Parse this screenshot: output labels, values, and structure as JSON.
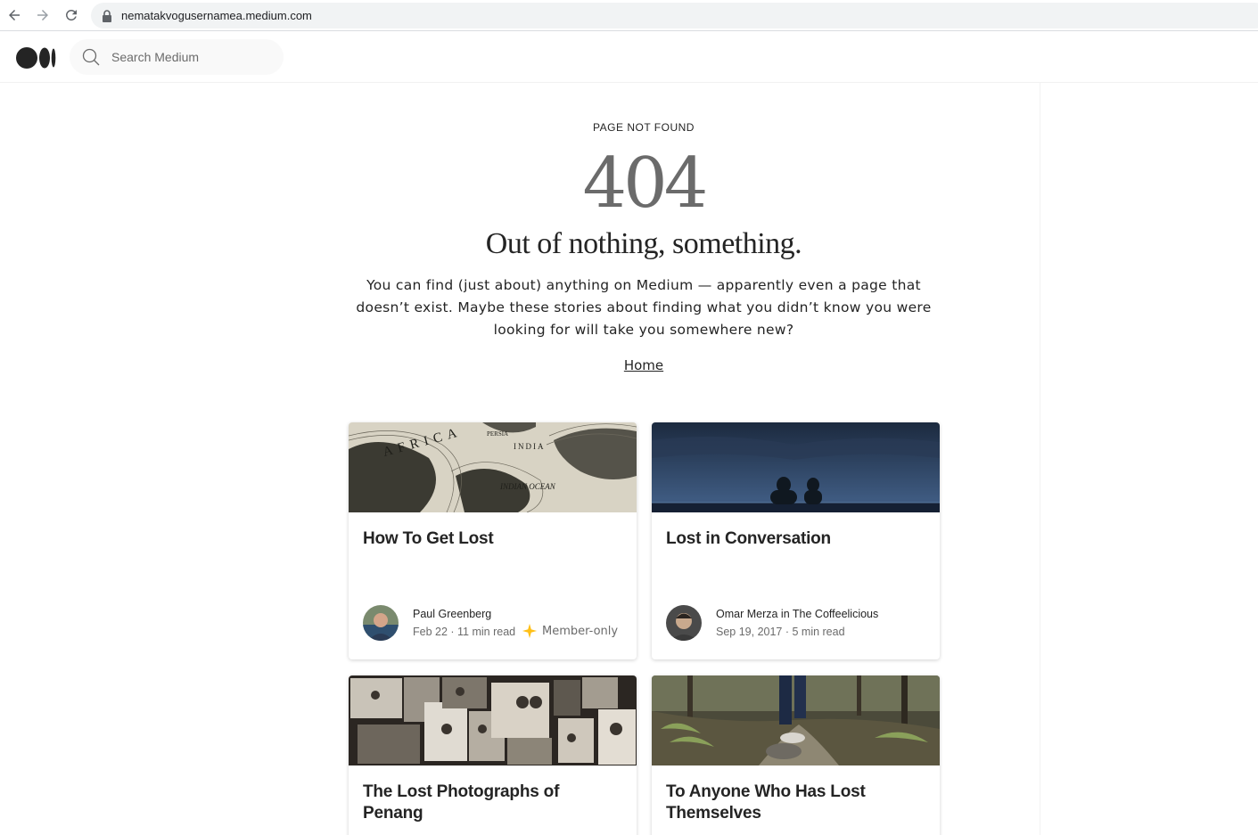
{
  "browser": {
    "url": "nematakvogusernamea.medium.com"
  },
  "header": {
    "search_placeholder": "Search Medium"
  },
  "main": {
    "eyebrow": "PAGE NOT FOUND",
    "code": "404",
    "headline": "Out of nothing, something.",
    "body": "You can find (just about) anything on Medium — apparently even a page that doesn’t exist. Maybe these stories about finding what you didn’t know you were looking for will take you somewhere new?",
    "home_link": "Home"
  },
  "cards": [
    {
      "title": "How To Get Lost",
      "author": "Paul Greenberg",
      "meta": "Feb 22 · 11 min read",
      "badge": "Member-only",
      "badge_color": "#ffc017"
    },
    {
      "title": "Lost in Conversation",
      "author": "Omar Merza in The Coffeelicious",
      "meta": "Sep 19, 2017 · 5 min read"
    },
    {
      "title": "The Lost Photographs of Penang"
    },
    {
      "title": "To Anyone Who Has Lost Themselves"
    }
  ],
  "icons": {
    "back": "arrow-left-icon",
    "forward": "arrow-right-icon",
    "reload": "reload-icon",
    "lock": "lock-icon",
    "search": "search-icon",
    "member": "sparkle-star-icon"
  }
}
